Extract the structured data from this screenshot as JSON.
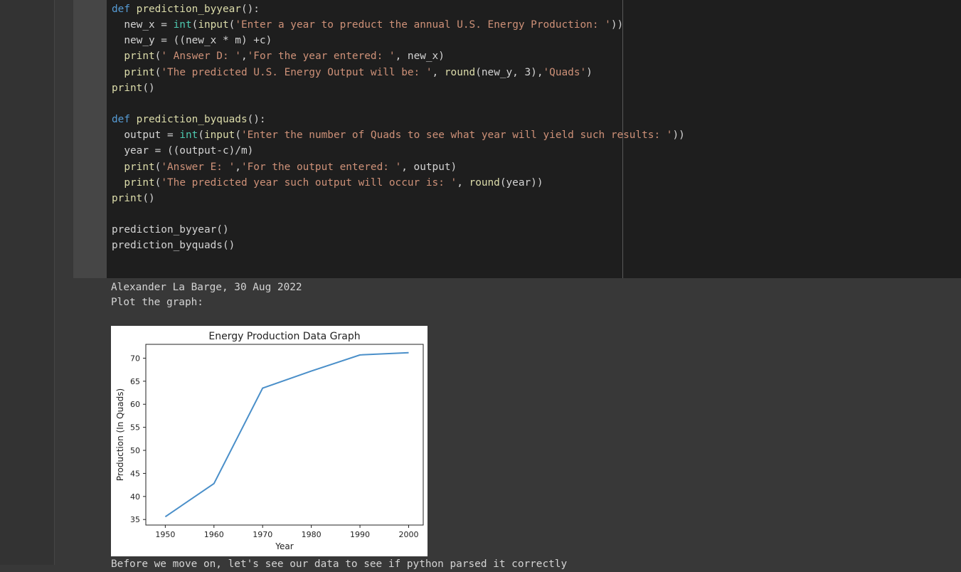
{
  "code": {
    "lines": [
      [
        {
          "t": "def ",
          "c": "kw"
        },
        {
          "t": "prediction_byyear",
          "c": "fn"
        },
        {
          "t": "():",
          "c": ""
        }
      ],
      [
        {
          "t": "  new_x = ",
          "c": ""
        },
        {
          "t": "int",
          "c": "bi"
        },
        {
          "t": "(",
          "c": ""
        },
        {
          "t": "input",
          "c": "fn"
        },
        {
          "t": "(",
          "c": ""
        },
        {
          "t": "'Enter a year to preduct the annual U.S. Energy Production: '",
          "c": "str"
        },
        {
          "t": "))",
          "c": ""
        }
      ],
      [
        {
          "t": "  new_y = ((new_x * m) +c)",
          "c": ""
        }
      ],
      [
        {
          "t": "  ",
          "c": ""
        },
        {
          "t": "print",
          "c": "fn"
        },
        {
          "t": "(",
          "c": ""
        },
        {
          "t": "' Answer D: '",
          "c": "str"
        },
        {
          "t": ",",
          "c": ""
        },
        {
          "t": "'For the year entered: '",
          "c": "str"
        },
        {
          "t": ", new_x)",
          "c": ""
        }
      ],
      [
        {
          "t": "  ",
          "c": ""
        },
        {
          "t": "print",
          "c": "fn"
        },
        {
          "t": "(",
          "c": ""
        },
        {
          "t": "'The predicted U.S. Energy Output will be: '",
          "c": "str"
        },
        {
          "t": ", ",
          "c": ""
        },
        {
          "t": "round",
          "c": "fn"
        },
        {
          "t": "(new_y, 3),",
          "c": ""
        },
        {
          "t": "'Quads'",
          "c": "str"
        },
        {
          "t": ")",
          "c": ""
        }
      ],
      [
        {
          "t": "print",
          "c": "fn"
        },
        {
          "t": "()",
          "c": ""
        }
      ],
      [],
      [
        {
          "t": "def ",
          "c": "kw"
        },
        {
          "t": "prediction_byquads",
          "c": "fn"
        },
        {
          "t": "():",
          "c": ""
        }
      ],
      [
        {
          "t": "  output = ",
          "c": ""
        },
        {
          "t": "int",
          "c": "bi"
        },
        {
          "t": "(",
          "c": ""
        },
        {
          "t": "input",
          "c": "fn"
        },
        {
          "t": "(",
          "c": ""
        },
        {
          "t": "'Enter the number of Quads to see what year will yield such results: '",
          "c": "str"
        },
        {
          "t": "))",
          "c": ""
        }
      ],
      [
        {
          "t": "  year = ((output-c)/m)",
          "c": ""
        }
      ],
      [
        {
          "t": "  ",
          "c": ""
        },
        {
          "t": "print",
          "c": "fn"
        },
        {
          "t": "(",
          "c": ""
        },
        {
          "t": "'Answer E: '",
          "c": "str"
        },
        {
          "t": ",",
          "c": ""
        },
        {
          "t": "'For the output entered: '",
          "c": "str"
        },
        {
          "t": ", output)",
          "c": ""
        }
      ],
      [
        {
          "t": "  ",
          "c": ""
        },
        {
          "t": "print",
          "c": "fn"
        },
        {
          "t": "(",
          "c": ""
        },
        {
          "t": "'The predicted year such output will occur is: '",
          "c": "str"
        },
        {
          "t": ", ",
          "c": ""
        },
        {
          "t": "round",
          "c": "fn"
        },
        {
          "t": "(year))",
          "c": ""
        }
      ],
      [
        {
          "t": "print",
          "c": "fn"
        },
        {
          "t": "()",
          "c": ""
        }
      ],
      [],
      [
        {
          "t": "prediction_byyear()",
          "c": ""
        }
      ],
      [
        {
          "t": "prediction_byquads()",
          "c": ""
        }
      ]
    ]
  },
  "markdown": {
    "author_line": "Alexander La Barge, 30 Aug 2022",
    "plot_line": "Plot the graph:",
    "next_line": "Before we move on, let's see our data to see if python parsed it correctly"
  },
  "chart_data": {
    "type": "line",
    "title": "Energy Production Data Graph",
    "xlabel": "Year",
    "ylabel": "Production (In Quads)",
    "x": [
      1950,
      1960,
      1970,
      1980,
      1990,
      2000
    ],
    "y": [
      35.6,
      42.8,
      63.5,
      67.2,
      70.7,
      71.2
    ],
    "xticks": [
      1950,
      1960,
      1970,
      1980,
      1990,
      2000
    ],
    "yticks": [
      35,
      40,
      45,
      50,
      55,
      60,
      65,
      70
    ],
    "xlim": [
      1946,
      2003
    ],
    "ylim": [
      33.8,
      73.0
    ],
    "grid": false,
    "line_color": "#4a8fc9"
  }
}
